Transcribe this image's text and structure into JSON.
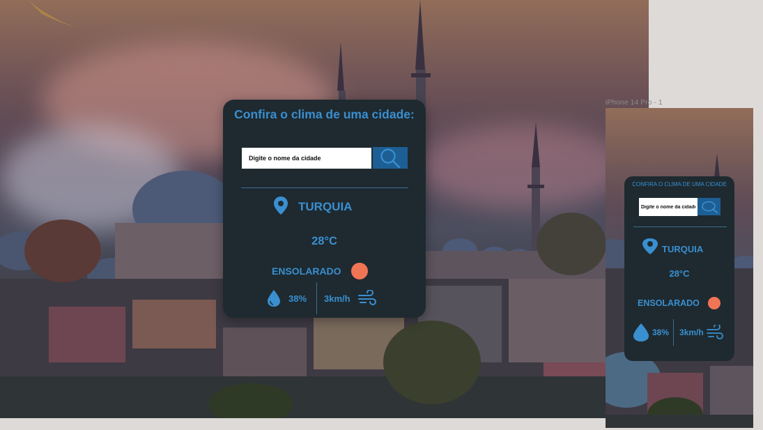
{
  "desktop": {
    "title": "Confira o clima de uma cidade:",
    "search": {
      "placeholder": "Digite o nome da cidade"
    },
    "location": "TURQUIA",
    "temperature": "28°C",
    "condition": "ENSOLARADO",
    "humidity": "38%",
    "wind": "3km/h"
  },
  "mobile": {
    "frame_label": "iPhone 14 Pro - 1",
    "title": "CONFIRA O CLIMA DE UMA CIDADE",
    "search": {
      "placeholder": "Digite o nome da cidade"
    },
    "location": "TURQUIA",
    "temperature": "28°C",
    "condition": "ENSOLARADO",
    "humidity": "38%",
    "wind": "3km/h"
  },
  "colors": {
    "card_bg": "#1e2a30",
    "accent": "#3a8fd0",
    "button": "#1d5f95",
    "sun": "#f07555"
  },
  "icons": [
    "search-icon",
    "location-pin-icon",
    "sun-icon",
    "water-drop-icon",
    "wind-icon"
  ]
}
